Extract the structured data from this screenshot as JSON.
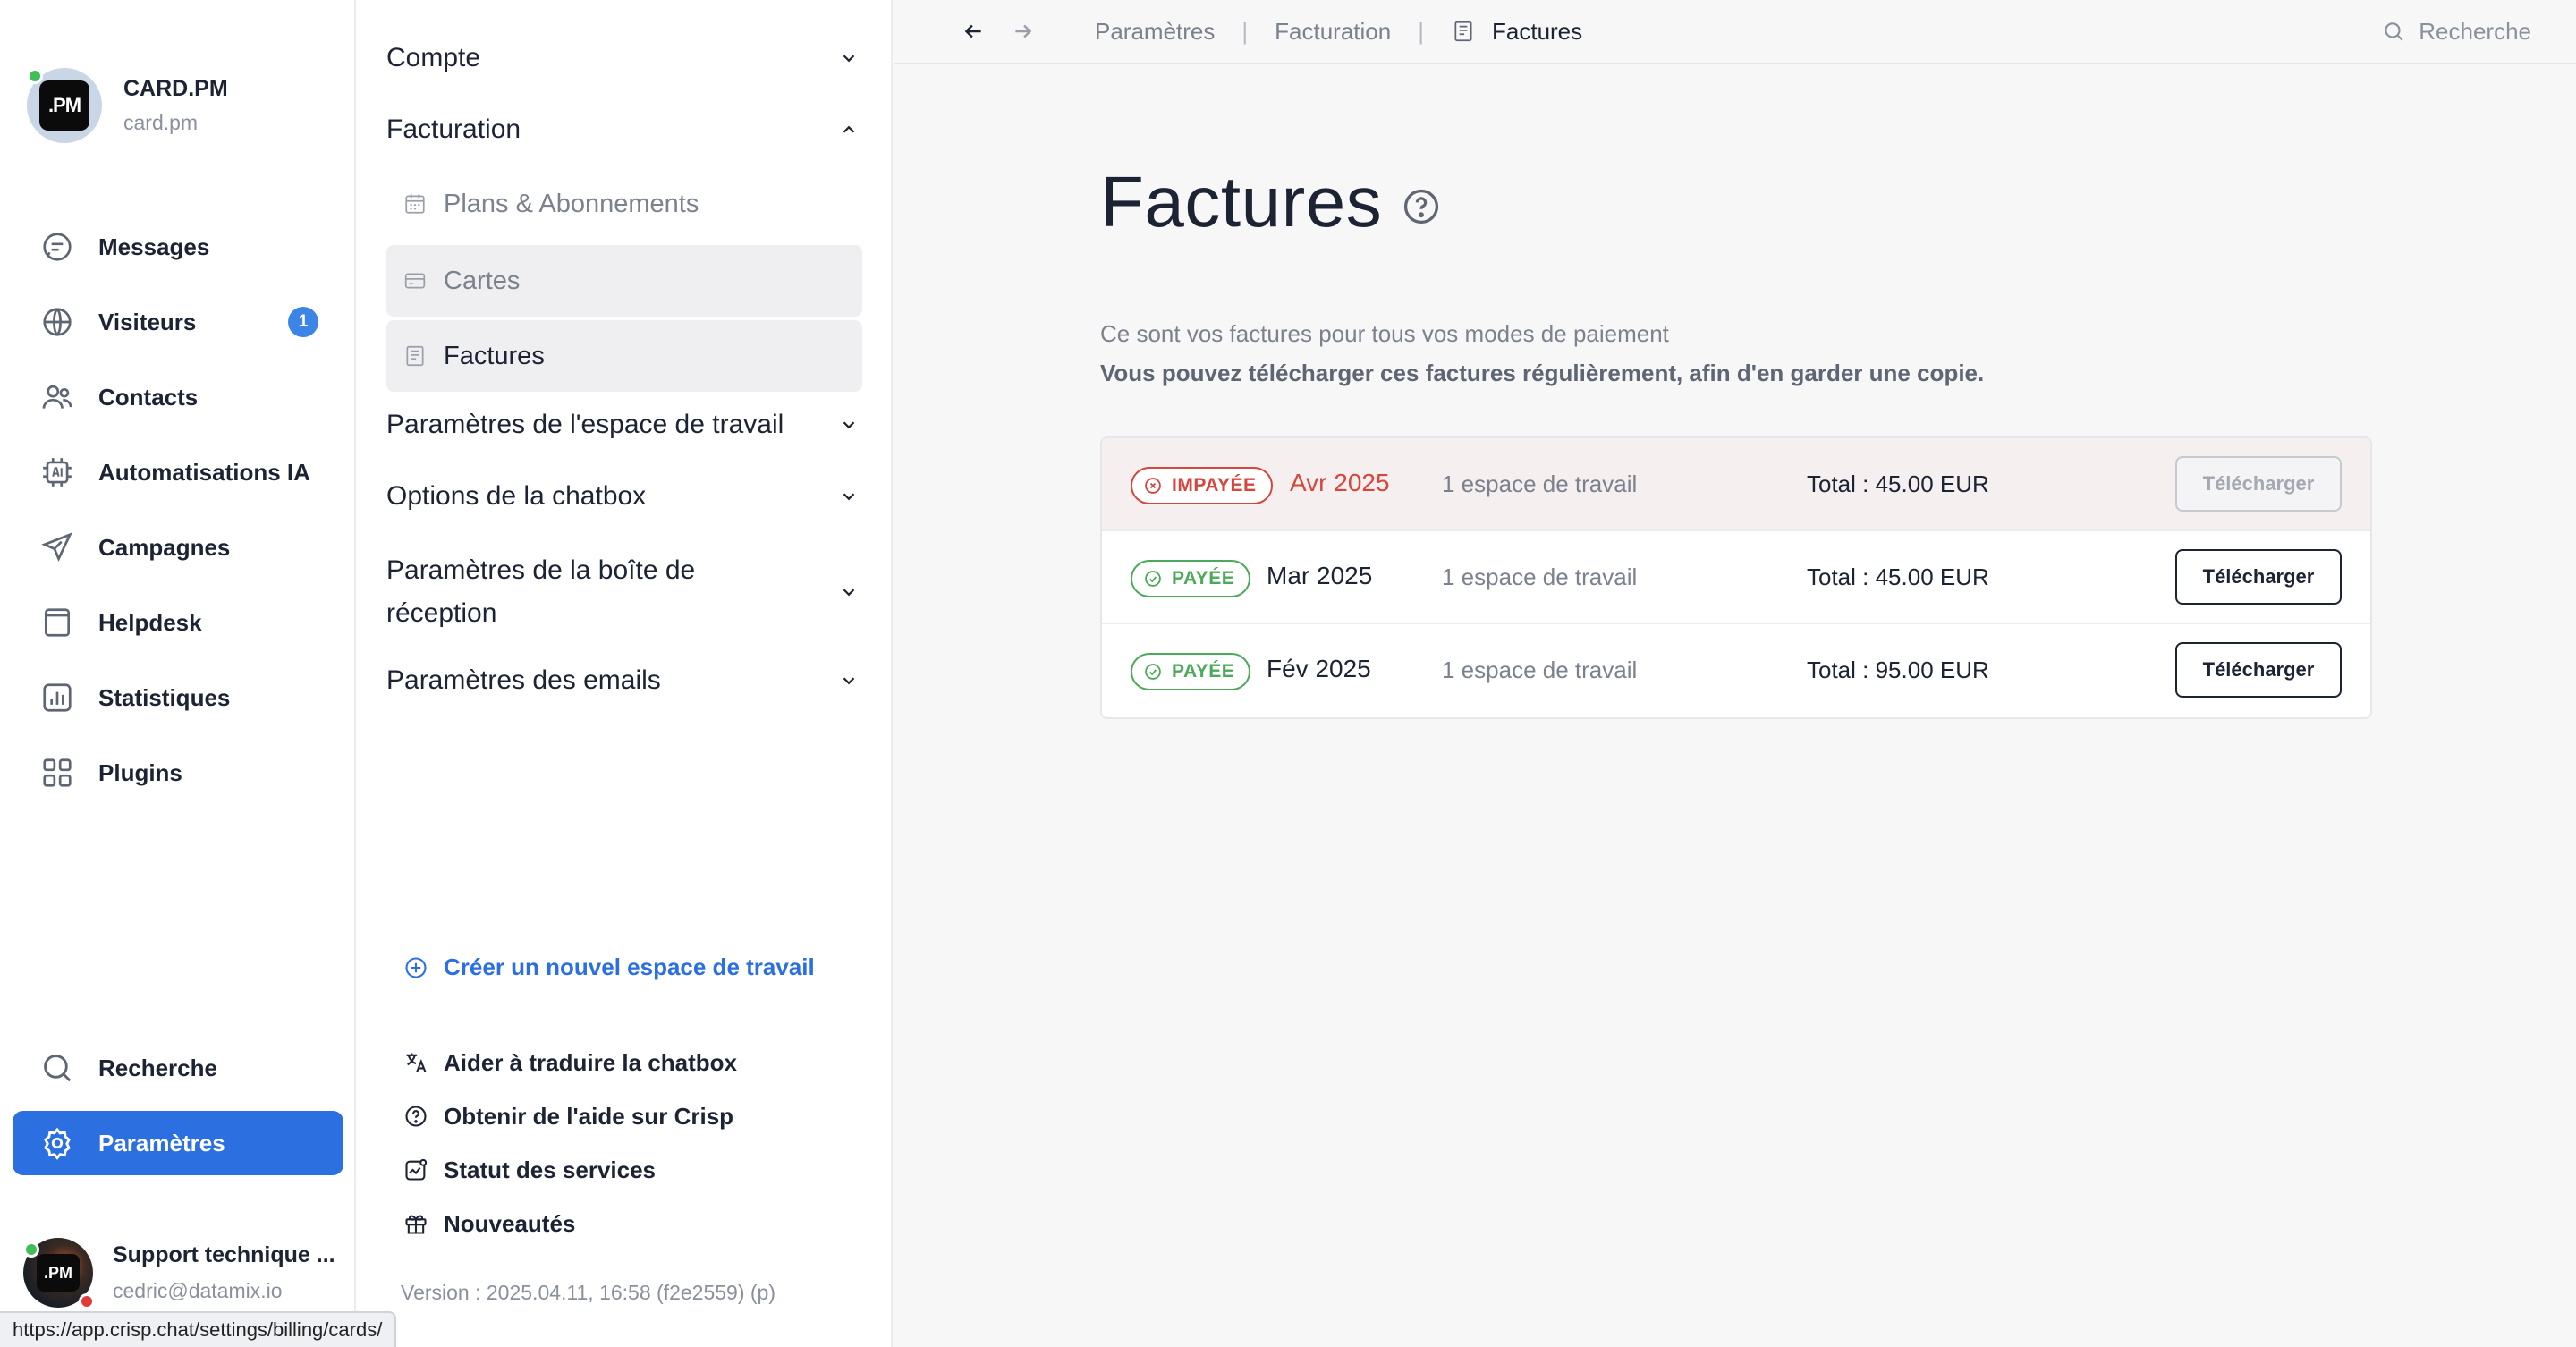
{
  "workspace": {
    "name": "CARD.PM",
    "domain": "card.pm",
    "avatar_text": ".PM"
  },
  "nav": {
    "items": [
      {
        "label": "Messages",
        "icon": "messages-icon"
      },
      {
        "label": "Visiteurs",
        "icon": "globe-icon",
        "badge": "1"
      },
      {
        "label": "Contacts",
        "icon": "contacts-icon"
      },
      {
        "label": "Automatisations IA",
        "icon": "ai-chip-icon"
      },
      {
        "label": "Campagnes",
        "icon": "paper-plane-icon"
      },
      {
        "label": "Helpdesk",
        "icon": "helpdesk-icon"
      },
      {
        "label": "Statistiques",
        "icon": "chart-icon"
      },
      {
        "label": "Plugins",
        "icon": "plugins-icon"
      }
    ],
    "search_label": "Recherche",
    "settings_label": "Paramètres"
  },
  "profile": {
    "name": "Support technique ...",
    "email": "cedric@datamix.io",
    "avatar_text": ".PM"
  },
  "status_url": "https://app.crisp.chat/settings/billing/cards/",
  "settings_menu": {
    "compte": "Compte",
    "facturation": "Facturation",
    "facturation_items": [
      "Plans & Abonnements",
      "Cartes",
      "Factures"
    ],
    "workspace_settings": "Paramètres de l'espace de travail",
    "chatbox_options": "Options de la chatbox",
    "inbox_settings_line1": "Paramètres de la boîte de",
    "inbox_settings_line2": "réception",
    "email_settings": "Paramètres des emails",
    "create_workspace": "Créer un nouvel espace de travail",
    "links": [
      "Aider à traduire la chatbox",
      "Obtenir de l'aide sur Crisp",
      "Statut des services",
      "Nouveautés"
    ],
    "version": "Version : 2025.04.11, 16:58 (f2e2559) (p)"
  },
  "topbar": {
    "crumbs": [
      "Paramètres",
      "Facturation",
      "Factures"
    ],
    "search": "Recherche"
  },
  "page": {
    "title": "Factures",
    "desc1": "Ce sont vos factures pour tous vos modes de paiement",
    "desc2": "Vous pouvez télécharger ces factures régulièrement, afin d'en garder une copie."
  },
  "invoices": [
    {
      "status": "IMPAYÉE",
      "period": "Avr 2025",
      "workspaces": "1 espace de travail",
      "total": "Total : 45.00 EUR",
      "action": "Télécharger"
    },
    {
      "status": "PAYÉE",
      "period": "Mar 2025",
      "workspaces": "1 espace de travail",
      "total": "Total : 45.00 EUR",
      "action": "Télécharger"
    },
    {
      "status": "PAYÉE",
      "period": "Fév 2025",
      "workspaces": "1 espace de travail",
      "total": "Total : 95.00 EUR",
      "action": "Télécharger"
    }
  ],
  "colors": {
    "accent": "#2c6fe0",
    "unpaid": "#d6453e",
    "paid": "#4da95a",
    "badge": "#3c84e5"
  }
}
